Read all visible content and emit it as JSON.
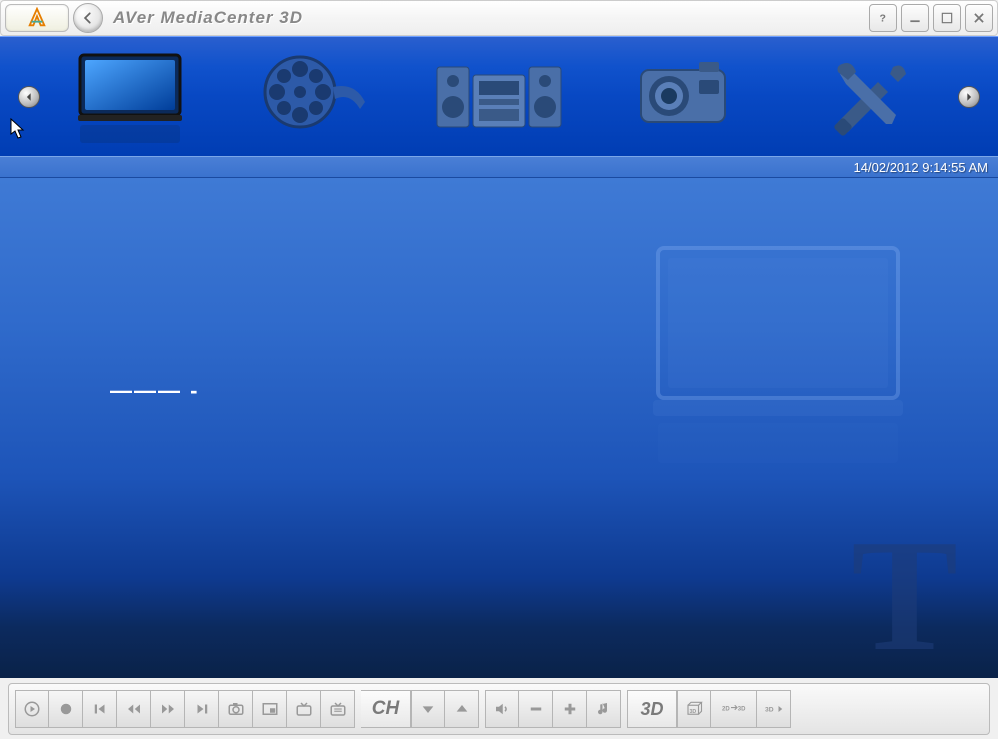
{
  "titlebar": {
    "title": "AVer MediaCenter 3D"
  },
  "status": {
    "datetime": "14/02/2012 9:14:55 AM"
  },
  "content": {
    "no_signal": "———   -"
  },
  "nav_items": [
    {
      "id": "tv",
      "label": "TV"
    },
    {
      "id": "video",
      "label": "Video"
    },
    {
      "id": "music",
      "label": "Music"
    },
    {
      "id": "pictures",
      "label": "Pictures"
    },
    {
      "id": "settings",
      "label": "Settings"
    }
  ],
  "channel": {
    "label": "CH"
  },
  "threeD": {
    "label": "3D"
  },
  "toolbar_buttons": {
    "play": "▶",
    "record": "●",
    "prev": "|◀",
    "rewind": "◀◀",
    "forward": "▶▶",
    "next": "▶|",
    "snapshot": "📷",
    "pip": "▭",
    "tv_mode": "📺",
    "teletext": "📺",
    "ch_down": "▼",
    "ch_up": "▲",
    "mute": "🔈",
    "vol_down": "−",
    "vol_up": "+",
    "audio": "♪",
    "3d_box": "3D",
    "2d3d": "2D/3D",
    "3d_arrow": "3D▸"
  }
}
